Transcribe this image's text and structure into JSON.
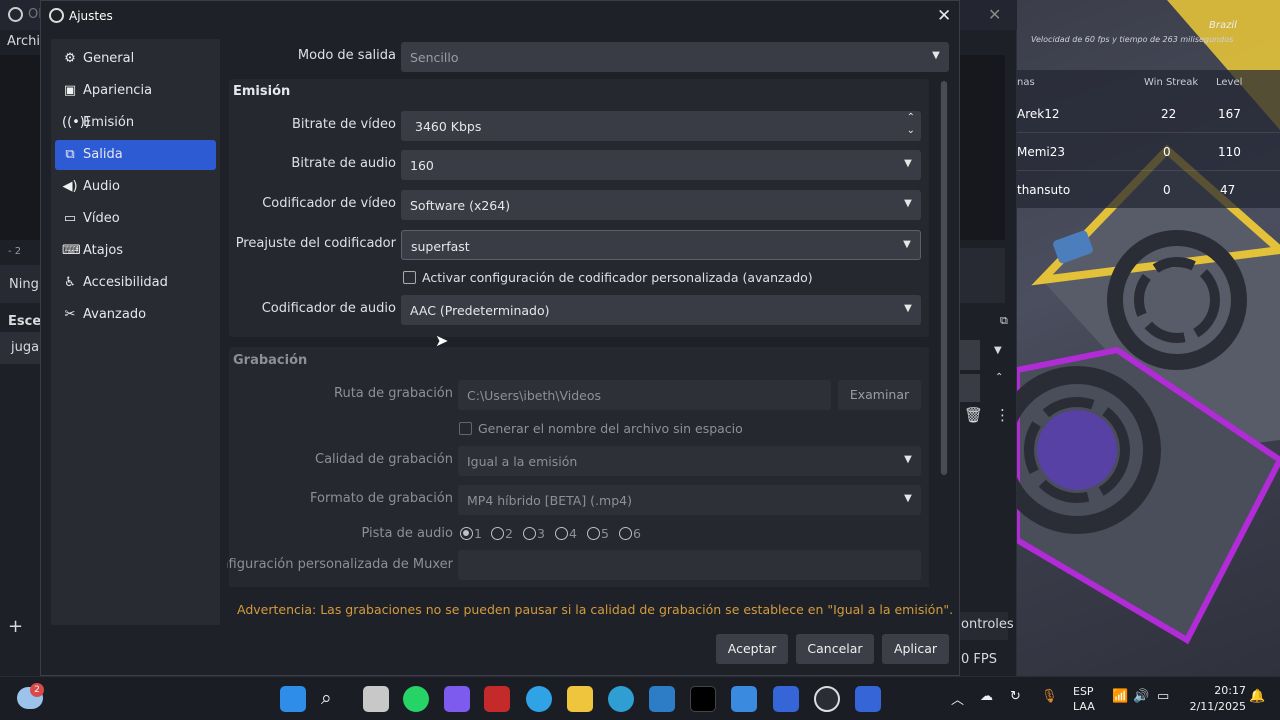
{
  "background": {
    "obs_title": "OB",
    "menu_archivo": "Archiv",
    "ninguno": "Ningu",
    "escenas": "Escen",
    "scene_item": "jugar",
    "controles": "ontroles",
    "fps": "0 FPS",
    "minus": "- 2"
  },
  "game": {
    "region": "Brazil",
    "speed_note": "Velocidad de 60 fps y tiempo de 263 milisegundos",
    "headers": {
      "name": "nas",
      "streak": "Win Streak",
      "level": "Level"
    },
    "rows": [
      {
        "name": "Arek12",
        "streak": "22",
        "level": "167"
      },
      {
        "name": "Memi23",
        "streak": "0",
        "level": "110"
      },
      {
        "name": "thansuto",
        "streak": "0",
        "level": "47"
      }
    ]
  },
  "dialog": {
    "title": "Ajustes",
    "close": "✕",
    "sidebar": [
      {
        "label": "General",
        "icon": "gear-icon"
      },
      {
        "label": "Apariencia",
        "icon": "appearance-icon"
      },
      {
        "label": "Emisión",
        "icon": "broadcast-icon"
      },
      {
        "label": "Salida",
        "icon": "output-icon"
      },
      {
        "label": "Audio",
        "icon": "speaker-icon"
      },
      {
        "label": "Vídeo",
        "icon": "monitor-icon"
      },
      {
        "label": "Atajos",
        "icon": "keyboard-icon"
      },
      {
        "label": "Accesibilidad",
        "icon": "accessibility-icon"
      },
      {
        "label": "Avanzado",
        "icon": "wrench-icon"
      }
    ],
    "output_mode": {
      "label": "Modo de salida",
      "value": "Sencillo"
    },
    "streaming": {
      "title": "Emisión",
      "video_bitrate": {
        "label": "Bitrate de vídeo",
        "value": "3460 Kbps"
      },
      "audio_bitrate": {
        "label": "Bitrate de audio",
        "value": "160"
      },
      "video_encoder": {
        "label": "Codificador de vídeo",
        "value": "Software (x264)"
      },
      "encoder_preset": {
        "label": "Preajuste del codificador",
        "value": "superfast"
      },
      "custom_encoder": "Activar configuración de codificador personalizada (avanzado)",
      "audio_encoder": {
        "label": "Codificador de audio",
        "value": "AAC (Predeterminado)"
      }
    },
    "recording": {
      "title": "Grabación",
      "path": {
        "label": "Ruta de grabación",
        "value": "C:\\Users\\ibeth\\Videos",
        "browse": "Examinar"
      },
      "no_space": "Generar el nombre del archivo sin espacio",
      "quality": {
        "label": "Calidad de grabación",
        "value": "Igual a la emisión"
      },
      "format": {
        "label": "Formato de grabación",
        "value": "MP4 híbrido [BETA] (.mp4)"
      },
      "audio_track": {
        "label": "Pista de audio",
        "options": [
          "1",
          "2",
          "3",
          "4",
          "5",
          "6"
        ]
      },
      "muxer": {
        "label": "Configuración personalizada de Muxer",
        "value": ""
      }
    },
    "warning": "Advertencia: Las grabaciones no se pueden pausar si la calidad de grabación se establece en \"Igual a la emisión\".",
    "buttons": {
      "accept": "Aceptar",
      "cancel": "Cancelar",
      "apply": "Aplicar"
    }
  },
  "taskbar": {
    "badge": "2",
    "lang": "ESP",
    "lang2": "LAA",
    "time": "20:17",
    "date": "2/11/2025"
  },
  "colors": {
    "accent": "#2c5bd4",
    "warning": "#d39b3c"
  }
}
